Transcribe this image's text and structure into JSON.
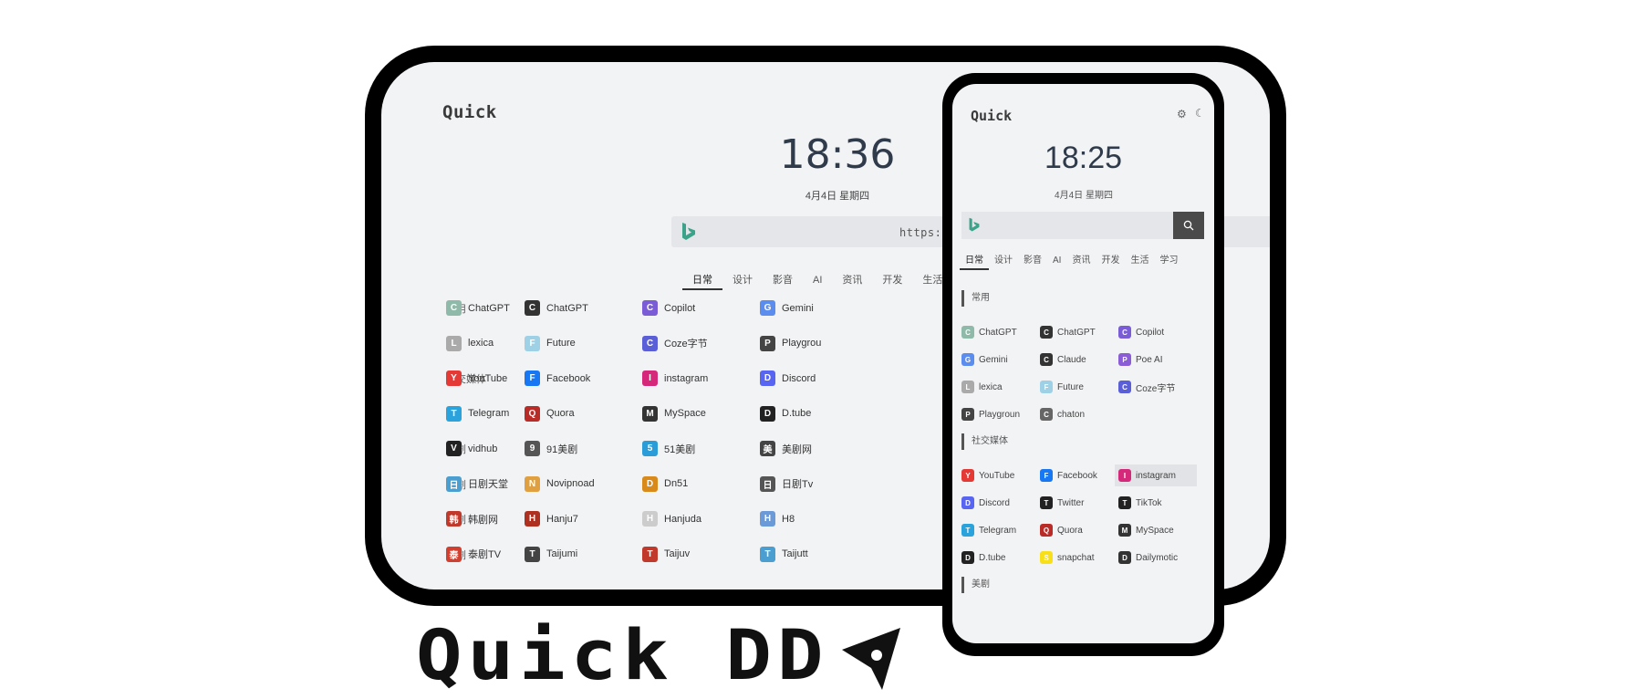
{
  "tablet": {
    "logo": "Quick",
    "time": "18:36",
    "date": "4月4日  星期四",
    "search_placeholder": "",
    "url_overlay": "https://quick.fastkj.top",
    "tabs": [
      "日常",
      "设计",
      "影音",
      "AI",
      "资讯",
      "开发",
      "生活"
    ],
    "rows": [
      {
        "cat": "常用",
        "items": [
          {
            "label": "ChatGPT",
            "icon": "chatgpt-icon",
            "color": "#8fb9a8"
          },
          {
            "label": "ChatGPT",
            "icon": "chatgpt-icon",
            "color": "#333333"
          },
          {
            "label": "Copilot",
            "icon": "copilot-icon",
            "color": "#7a5cd6"
          },
          {
            "label": "Gemini",
            "icon": "gemini-icon",
            "color": "#5b8def"
          }
        ]
      },
      {
        "cat": "",
        "items": [
          {
            "label": "lexica",
            "icon": "lexica-icon",
            "color": "#aaaaaa"
          },
          {
            "label": "Future",
            "icon": "future-icon",
            "color": "#9ed0e6"
          },
          {
            "label": "Coze字节",
            "icon": "coze-icon",
            "color": "#5a5fd8"
          },
          {
            "label": "Playgrou",
            "icon": "playground-icon",
            "color": "#444444"
          }
        ]
      },
      {
        "cat": "社交媒体",
        "items": [
          {
            "label": "YouTube",
            "icon": "youtube-icon",
            "color": "#e53935"
          },
          {
            "label": "Facebook",
            "icon": "facebook-icon",
            "color": "#1877f2"
          },
          {
            "label": "instagram",
            "icon": "instagram-icon",
            "color": "#d6287a"
          },
          {
            "label": "Discord",
            "icon": "discord-icon",
            "color": "#5865f2"
          }
        ]
      },
      {
        "cat": "",
        "items": [
          {
            "label": "Telegram",
            "icon": "telegram-icon",
            "color": "#2aa3dd"
          },
          {
            "label": "Quora",
            "icon": "quora-icon",
            "color": "#b92b27"
          },
          {
            "label": "MySpace",
            "icon": "myspace-icon",
            "color": "#333333"
          },
          {
            "label": "D.tube",
            "icon": "dtube-icon",
            "color": "#222222"
          }
        ]
      },
      {
        "cat": "美剧",
        "items": [
          {
            "label": "vidhub",
            "icon": "vidhub-icon",
            "color": "#222222"
          },
          {
            "label": "91美剧",
            "icon": "91meiju-icon",
            "color": "#555555"
          },
          {
            "label": "51美剧",
            "icon": "51meiju-icon",
            "color": "#2a9dd8"
          },
          {
            "label": "美剧网",
            "icon": "meijuwang-icon",
            "color": "#444444"
          }
        ]
      },
      {
        "cat": "日剧",
        "items": [
          {
            "label": "日剧天堂",
            "icon": "rijutiantang-icon",
            "color": "#4a9fd0"
          },
          {
            "label": "Novipnoad",
            "icon": "novipnoad-icon",
            "color": "#e0a040"
          },
          {
            "label": "Dn51",
            "icon": "dn51-icon",
            "color": "#d88a1a"
          },
          {
            "label": "日剧Tv",
            "icon": "rijutv-icon",
            "color": "#555555"
          }
        ]
      },
      {
        "cat": "韩剧",
        "items": [
          {
            "label": "韩剧网",
            "icon": "hanjuwang-icon",
            "color": "#c0392b"
          },
          {
            "label": "Hanju7",
            "icon": "hanju7-icon",
            "color": "#b03020"
          },
          {
            "label": "Hanjuda",
            "icon": "hanjuda-icon",
            "color": "#cccccc"
          },
          {
            "label": "H8",
            "icon": "h8-icon",
            "color": "#6a9ad8"
          }
        ]
      },
      {
        "cat": "泰剧",
        "items": [
          {
            "label": "泰剧TV",
            "icon": "taijutv-icon",
            "color": "#d04030"
          },
          {
            "label": "Taijumi",
            "icon": "taijumi-icon",
            "color": "#444444"
          },
          {
            "label": "Taijuv",
            "icon": "taijuv-icon",
            "color": "#c0392b"
          },
          {
            "label": "Taijutt",
            "icon": "taijutt-icon",
            "color": "#4a9fd0"
          }
        ]
      }
    ]
  },
  "phone": {
    "logo": "Quick",
    "time": "18:25",
    "date": "4月4日  星期四",
    "tabs": [
      "日常",
      "设计",
      "影音",
      "AI",
      "资讯",
      "开发",
      "生活",
      "学习"
    ],
    "sections": [
      {
        "title": "常用",
        "rows": [
          [
            {
              "label": "ChatGPT",
              "color": "#8fb9a8"
            },
            {
              "label": "ChatGPT",
              "color": "#333333"
            },
            {
              "label": "Copilot",
              "color": "#7a5cd6"
            }
          ],
          [
            {
              "label": "Gemini",
              "color": "#5b8def"
            },
            {
              "label": "Claude",
              "color": "#333333"
            },
            {
              "label": "Poe AI",
              "color": "#8a5cd6"
            }
          ],
          [
            {
              "label": "lexica",
              "color": "#aaaaaa"
            },
            {
              "label": "Future",
              "color": "#9ed0e6"
            },
            {
              "label": "Coze字节",
              "color": "#5a5fd8"
            }
          ],
          [
            {
              "label": "Playgroun",
              "color": "#444444"
            },
            {
              "label": "chaton",
              "color": "#666666"
            }
          ]
        ]
      },
      {
        "title": "社交媒体",
        "rows": [
          [
            {
              "label": "YouTube",
              "color": "#e53935"
            },
            {
              "label": "Facebook",
              "color": "#1877f2"
            },
            {
              "label": "instagram",
              "color": "#d6287a",
              "highlight": true
            }
          ],
          [
            {
              "label": "Discord",
              "color": "#5865f2"
            },
            {
              "label": "Twitter",
              "color": "#222222"
            },
            {
              "label": "TikTok",
              "color": "#222222"
            }
          ],
          [
            {
              "label": "Telegram",
              "color": "#2aa3dd"
            },
            {
              "label": "Quora",
              "color": "#b92b27"
            },
            {
              "label": "MySpace",
              "color": "#333333"
            }
          ],
          [
            {
              "label": "D.tube",
              "color": "#222222"
            },
            {
              "label": "snapchat",
              "color": "#f7e01a"
            },
            {
              "label": "Dailymotic",
              "color": "#333333"
            }
          ]
        ]
      },
      {
        "title": "美剧",
        "rows": []
      }
    ]
  },
  "brand": {
    "text": "Quick DD"
  }
}
